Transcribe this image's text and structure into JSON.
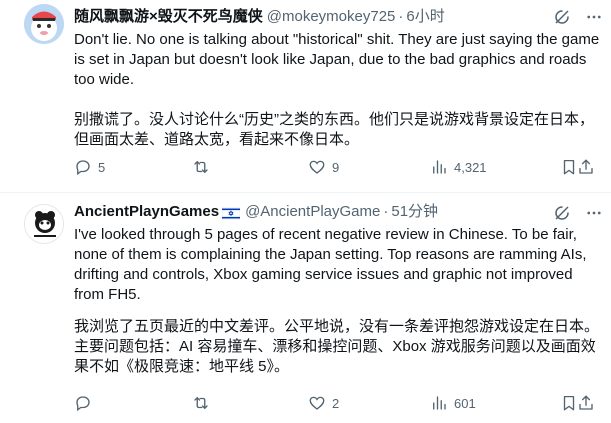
{
  "tweets": [
    {
      "display_name": "随风飘飘游×毁灭不死鸟魔侠",
      "handle": "@mokeymokey725",
      "separator": "·",
      "time": "6小时",
      "body_paragraphs": [
        "Don't lie. No one is talking about \"historical\" shit. They are just saying the game is set in Japan but doesn't look like Japan, due to the bad graphics and roads too wide.",
        "别撒谎了。没人讨论什么“历史”之类的东西。他们只是说游戏背景设定在日本，但画面太差、道路太宽，看起来不像日本。"
      ],
      "counts": {
        "replies": "5",
        "retweets": "",
        "likes": "9",
        "views": "4,321"
      }
    },
    {
      "display_name": "AncientPlaynGames",
      "handle": "@AncientPlayGame",
      "separator": "·",
      "time": "51分钟",
      "body_paragraphs": [
        "I've looked through 5 pages of recent negative review in Chinese. To be fair, none of them is complaining the Japan setting. Top reasons are ramming AIs, drifting and controls, Xbox gaming service issues and graphic not improved from FH5.",
        "我浏览了五页最近的中文差评。公平地说，没有一条差评抱怨游戏设定在日本。主要问题包括：AI 容易撞车、漂移和操控问题、Xbox 游戏服务问题以及画面效果不如《极限竞速：地平线 5》。"
      ],
      "counts": {
        "replies": "",
        "retweets": "",
        "likes": "2",
        "views": "601"
      }
    }
  ],
  "colors": {
    "text": "#0f1419",
    "secondary": "#536471",
    "divider": "#eff3f4",
    "flag_blue": "#0038b8"
  },
  "icons": [
    "grok-icon",
    "more-icon",
    "reply-icon",
    "retweet-icon",
    "like-icon",
    "views-icon",
    "bookmark-icon",
    "share-icon",
    "israel-flag-icon"
  ]
}
